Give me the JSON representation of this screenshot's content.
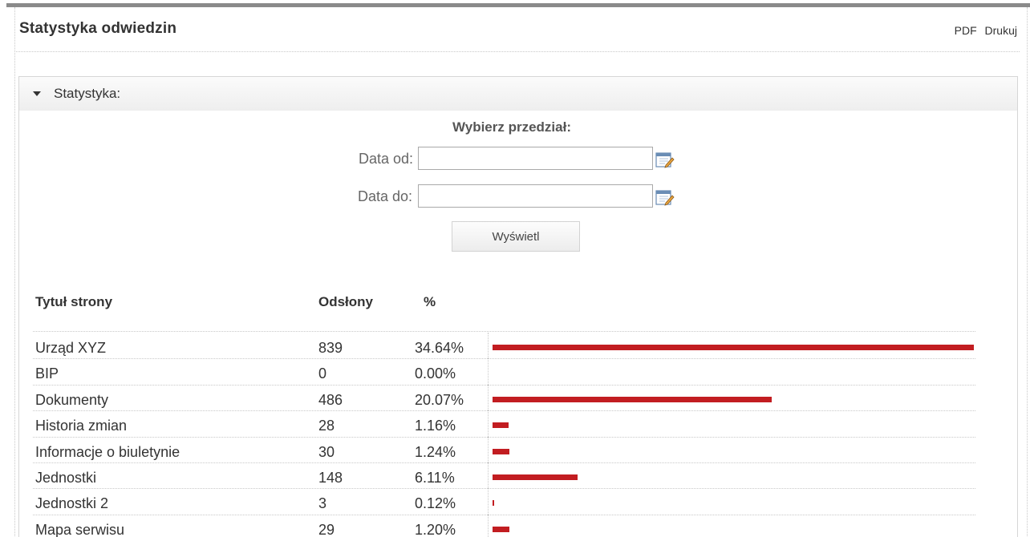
{
  "header": {
    "title": "Statystyka odwiedzin",
    "pdf_label": "PDF",
    "print_label": "Drukuj"
  },
  "panel": {
    "label": "Statystyka:",
    "range_title": "Wybierz przedział:",
    "date_from_label": "Data od:",
    "date_from_value": "",
    "date_to_label": "Data do:",
    "date_to_value": "",
    "show_button_label": "Wyświetl"
  },
  "icons": {
    "calendar_from": "calendar-icon",
    "calendar_to": "calendar-icon",
    "collapse": "caret-down-icon"
  },
  "colors": {
    "bar": "#c21d21",
    "rule": "#8a8a8a"
  },
  "table": {
    "columns": [
      "Tytuł strony",
      "Odsłony",
      "%"
    ],
    "rows": [
      {
        "title": "Urząd XYZ",
        "views": "839",
        "percent": "34.64%",
        "share": 34.64
      },
      {
        "title": "BIP",
        "views": "0",
        "percent": "0.00%",
        "share": 0.0
      },
      {
        "title": "Dokumenty",
        "views": "486",
        "percent": "20.07%",
        "share": 20.07
      },
      {
        "title": "Historia zmian",
        "views": "28",
        "percent": "1.16%",
        "share": 1.16
      },
      {
        "title": "Informacje o biuletynie",
        "views": "30",
        "percent": "1.24%",
        "share": 1.24
      },
      {
        "title": "Jednostki",
        "views": "148",
        "percent": "6.11%",
        "share": 6.11
      },
      {
        "title": "Jednostki 2",
        "views": "3",
        "percent": "0.12%",
        "share": 0.12
      },
      {
        "title": "Mapa serwisu",
        "views": "29",
        "percent": "1.20%",
        "share": 1.2
      }
    ]
  }
}
